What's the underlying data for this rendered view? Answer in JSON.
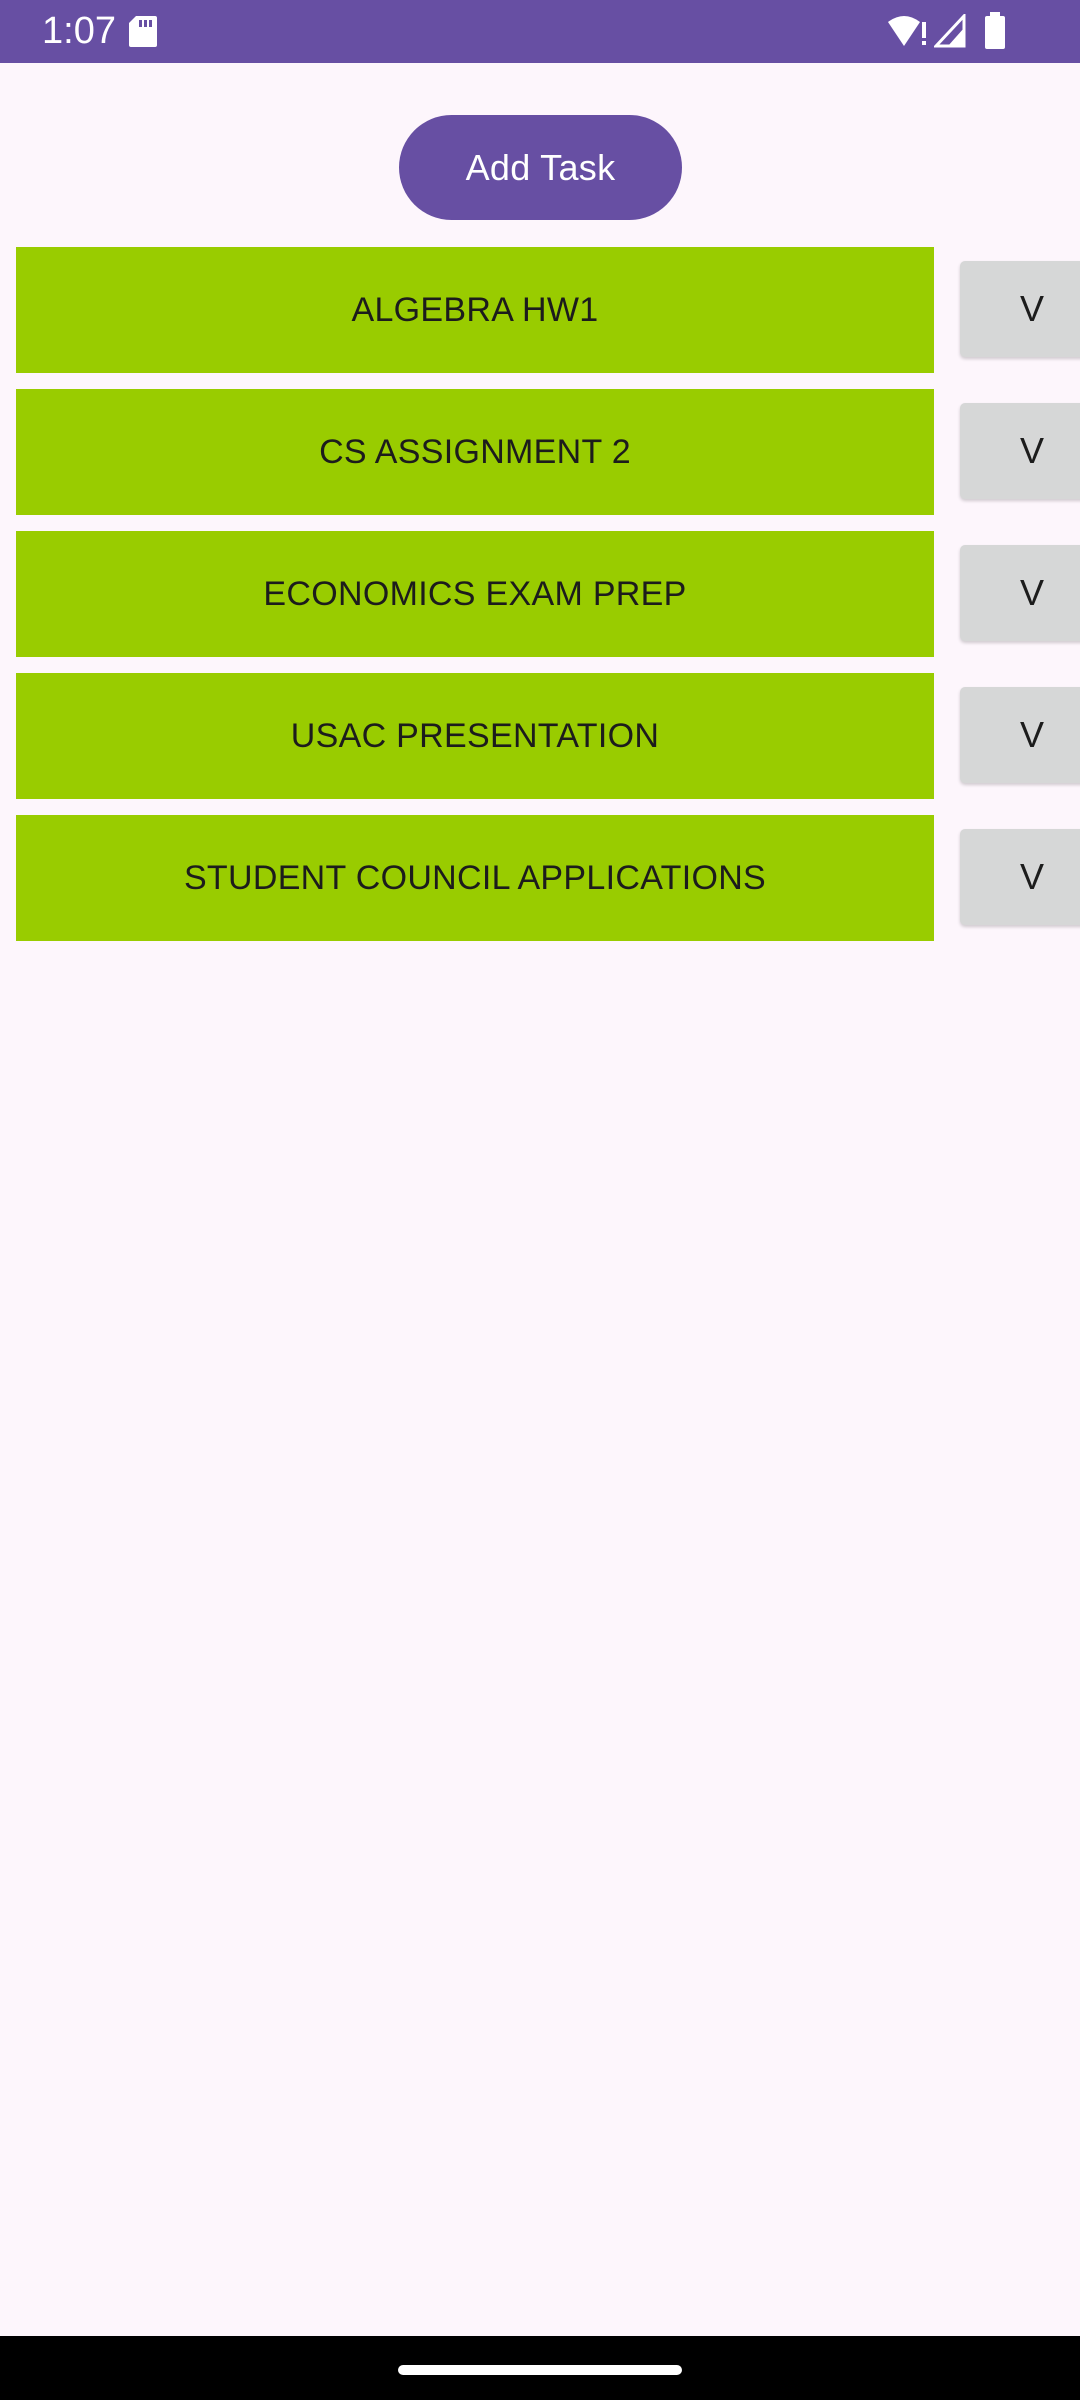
{
  "status_bar": {
    "time": "1:07",
    "background_color": "#674fa3",
    "icons": [
      "sd-card-icon",
      "wifi-icon",
      "signal-icon",
      "battery-icon"
    ]
  },
  "add_task_label": "Add Task",
  "colors": {
    "accent": "#674fa3",
    "task_green": "#99cc00",
    "check_gray": "#d6d7d7",
    "background": "#fdf6fc"
  },
  "tasks": [
    {
      "label": "ALGEBRA HW1",
      "check_label": "V"
    },
    {
      "label": "CS ASSIGNMENT 2",
      "check_label": "V"
    },
    {
      "label": "ECONOMICS EXAM PREP",
      "check_label": "V"
    },
    {
      "label": "USAC PRESENTATION",
      "check_label": "V"
    },
    {
      "label": "STUDENT COUNCIL APPLICATIONS",
      "check_label": "V"
    }
  ]
}
